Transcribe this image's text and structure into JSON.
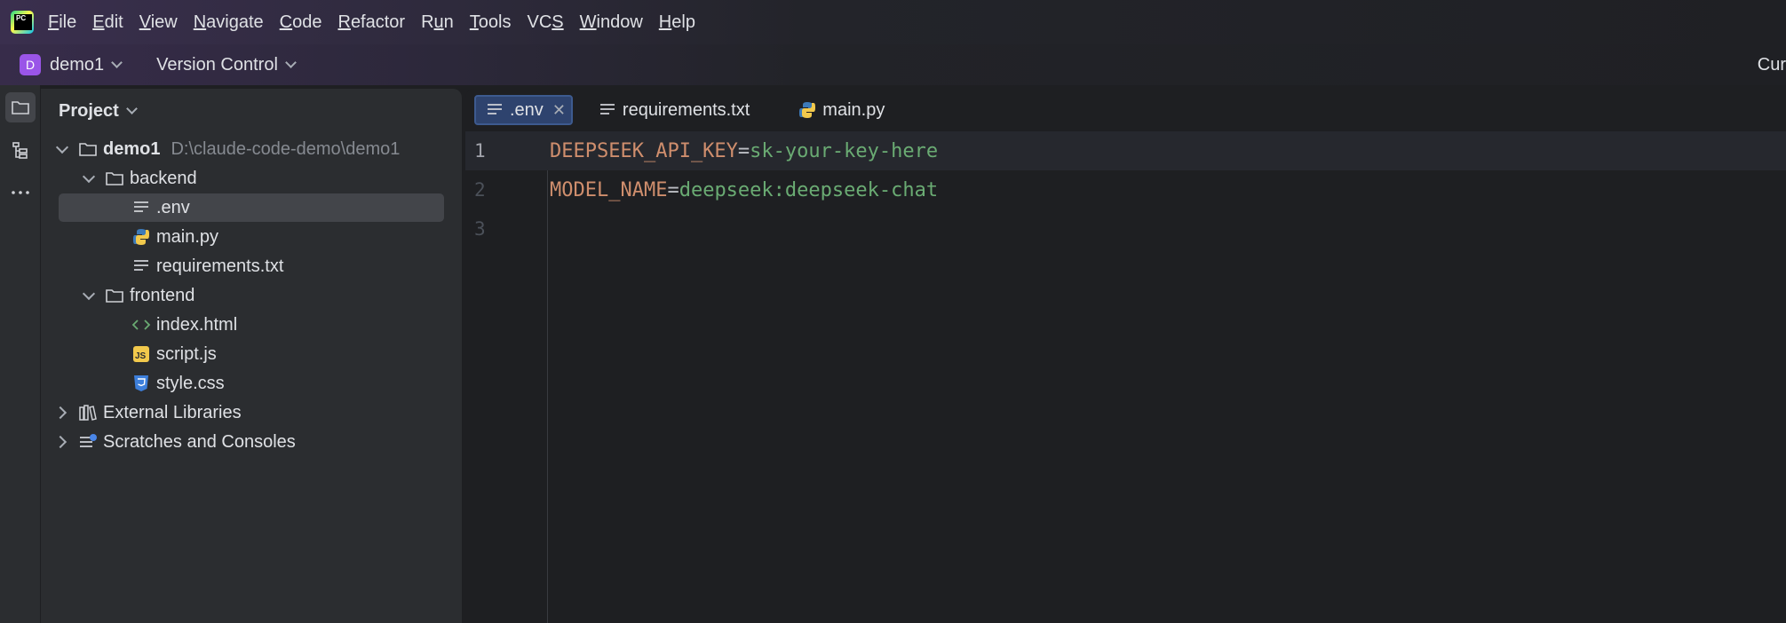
{
  "menubar": {
    "items": [
      {
        "pre": "",
        "u": "F",
        "post": "ile"
      },
      {
        "pre": "",
        "u": "E",
        "post": "dit"
      },
      {
        "pre": "",
        "u": "V",
        "post": "iew"
      },
      {
        "pre": "",
        "u": "N",
        "post": "avigate"
      },
      {
        "pre": "",
        "u": "C",
        "post": "ode"
      },
      {
        "pre": "",
        "u": "R",
        "post": "efactor"
      },
      {
        "pre": "R",
        "u": "u",
        "post": "n"
      },
      {
        "pre": "",
        "u": "T",
        "post": "ools"
      },
      {
        "pre": "VC",
        "u": "S",
        "post": ""
      },
      {
        "pre": "",
        "u": "W",
        "post": "indow"
      },
      {
        "pre": "",
        "u": "H",
        "post": "elp"
      }
    ]
  },
  "toolbar": {
    "project_badge": "D",
    "project_name": "demo1",
    "vcs_label": "Version Control",
    "right_text": "Cur"
  },
  "project_panel": {
    "title": "Project",
    "tree": [
      {
        "name": "demo1",
        "path": "D:\\claude-code-demo\\demo1",
        "icon": "folder-icon"
      },
      {
        "name": "backend",
        "icon": "folder-icon"
      },
      {
        "name": ".env",
        "icon": "text-file-icon"
      },
      {
        "name": "main.py",
        "icon": "python-file-icon"
      },
      {
        "name": "requirements.txt",
        "icon": "text-file-icon"
      },
      {
        "name": "frontend",
        "icon": "folder-icon"
      },
      {
        "name": "index.html",
        "icon": "html-file-icon"
      },
      {
        "name": "script.js",
        "icon": "js-file-icon"
      },
      {
        "name": "style.css",
        "icon": "css-file-icon"
      },
      {
        "name": "External Libraries",
        "icon": "library-icon"
      },
      {
        "name": "Scratches and Consoles",
        "icon": "scratches-icon"
      }
    ]
  },
  "editor": {
    "tabs": [
      {
        "label": ".env",
        "icon": "text-file-icon",
        "active": true
      },
      {
        "label": "requirements.txt",
        "icon": "text-file-icon",
        "active": false
      },
      {
        "label": "main.py",
        "icon": "python-file-icon",
        "active": false
      }
    ],
    "lines": [
      {
        "num": "1",
        "key": "DEEPSEEK_API_KEY",
        "eq": "=",
        "val": "sk-your-key-here"
      },
      {
        "num": "2",
        "key": "MODEL_NAME",
        "eq": "=",
        "val": "deepseek:deepseek-chat"
      },
      {
        "num": "3",
        "key": "",
        "eq": "",
        "val": ""
      }
    ]
  },
  "colors": {
    "accent": "#2e436e",
    "key": "#cf8e6d",
    "value": "#6aab73",
    "project_badge": "#9a55e8"
  }
}
